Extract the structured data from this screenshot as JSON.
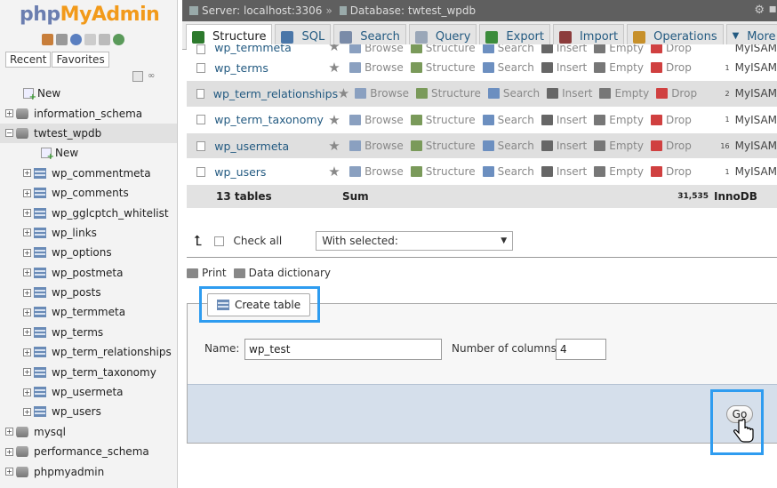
{
  "app": {
    "logo_php": "php",
    "logo_my": "MyAdmin"
  },
  "sidebar": {
    "tabs": [
      "Recent",
      "Favorites"
    ],
    "tree": [
      {
        "label": "New",
        "type": "new",
        "level": 0
      },
      {
        "label": "information_schema",
        "type": "db",
        "level": 0
      },
      {
        "label": "twtest_wpdb",
        "type": "db",
        "level": 0,
        "selected": true
      },
      {
        "label": "New",
        "type": "new",
        "level": 1
      },
      {
        "label": "wp_commentmeta",
        "type": "table",
        "level": 1
      },
      {
        "label": "wp_comments",
        "type": "table",
        "level": 1
      },
      {
        "label": "wp_gglcptch_whitelist",
        "type": "table",
        "level": 1
      },
      {
        "label": "wp_links",
        "type": "table",
        "level": 1
      },
      {
        "label": "wp_options",
        "type": "table",
        "level": 1
      },
      {
        "label": "wp_postmeta",
        "type": "table",
        "level": 1
      },
      {
        "label": "wp_posts",
        "type": "table",
        "level": 1
      },
      {
        "label": "wp_termmeta",
        "type": "table",
        "level": 1
      },
      {
        "label": "wp_terms",
        "type": "table",
        "level": 1
      },
      {
        "label": "wp_term_relationships",
        "type": "table",
        "level": 1
      },
      {
        "label": "wp_term_taxonomy",
        "type": "table",
        "level": 1
      },
      {
        "label": "wp_usermeta",
        "type": "table",
        "level": 1
      },
      {
        "label": "wp_users",
        "type": "table",
        "level": 1
      },
      {
        "label": "mysql",
        "type": "db",
        "level": 0
      },
      {
        "label": "performance_schema",
        "type": "db",
        "level": 0
      },
      {
        "label": "phpmyadmin",
        "type": "db",
        "level": 0
      }
    ]
  },
  "topbar": {
    "server": "Server: localhost:3306",
    "separator": "»",
    "database": "Database: twtest_wpdb"
  },
  "tabs": [
    {
      "label": "Structure",
      "active": true,
      "color": "#2d7a2d"
    },
    {
      "label": "SQL",
      "color": "#4a76a8"
    },
    {
      "label": "Search",
      "color": "#7a8ba8"
    },
    {
      "label": "Query",
      "color": "#9aa7b8"
    },
    {
      "label": "Export",
      "color": "#3c8c3c"
    },
    {
      "label": "Import",
      "color": "#8c3c3c"
    },
    {
      "label": "Operations",
      "color": "#c7902a"
    },
    {
      "label": "More",
      "color": "#333333"
    }
  ],
  "table_list": {
    "partial_top": {
      "name": "wp_termmeta",
      "rows": "",
      "engine": "MyISAM"
    },
    "rows": [
      {
        "name": "wp_terms",
        "rows": "1",
        "engine": "MyISAM"
      },
      {
        "name": "wp_term_relationships",
        "rows": "2",
        "engine": "MyISAM"
      },
      {
        "name": "wp_term_taxonomy",
        "rows": "1",
        "engine": "MyISAM"
      },
      {
        "name": "wp_usermeta",
        "rows": "16",
        "engine": "MyISAM"
      },
      {
        "name": "wp_users",
        "rows": "1",
        "engine": "MyISAM"
      }
    ],
    "actions": [
      "Browse",
      "Structure",
      "Search",
      "Insert",
      "Empty",
      "Drop"
    ],
    "action_colors": [
      "#8aa0c0",
      "#7a9a5a",
      "#6c8fc0",
      "#666666",
      "#777777",
      "#d04040"
    ],
    "summary": {
      "count": "13 tables",
      "sum": "Sum",
      "total": "31,535",
      "engine": "InnoDB"
    }
  },
  "controls": {
    "check_all": "Check all",
    "with_selected": "With selected:",
    "print": "Print",
    "data_dictionary": "Data dictionary"
  },
  "create_table": {
    "legend": "Create table",
    "name_label": "Name:",
    "name_value": "wp_test",
    "columns_label": "Number of columns:",
    "columns_value": "4",
    "go": "Go"
  }
}
